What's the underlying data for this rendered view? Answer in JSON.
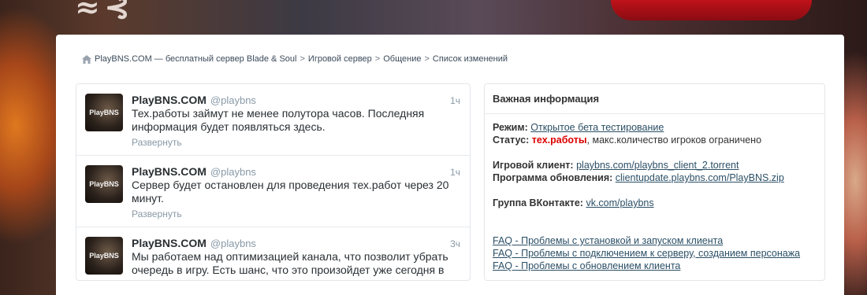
{
  "breadcrumb": {
    "home_icon": "home-icon",
    "items": [
      "PlayBNS.COM — бесплатный сервер Blade & Soul",
      "Игровой сервер",
      "Общение",
      "Список изменений"
    ],
    "separator": ">"
  },
  "tweets": [
    {
      "avatar_text": "PlayBNS",
      "name": "PlayBNS.COM",
      "handle": "@playbns",
      "time": "1ч",
      "text": "Тех.работы займут не менее полутора часов. Последняя информация будет появляться здесь.",
      "expand": "Развернуть"
    },
    {
      "avatar_text": "PlayBNS",
      "name": "PlayBNS.COM",
      "handle": "@playbns",
      "time": "1ч",
      "text": "Сервер будет остановлен для проведения тех.работ через 20 минут.",
      "expand": "Развернуть"
    },
    {
      "avatar_text": "PlayBNS",
      "name": "PlayBNS.COM",
      "handle": "@playbns",
      "time": "3ч",
      "text": "Мы работаем над оптимизацией канала, что позволит убрать очередь в игру. Есть шанс, что это произойдет уже сегодня в",
      "expand": ""
    }
  ],
  "info": {
    "title": "Важная информация",
    "mode_label": "Режим:",
    "mode_value": "Открытое бета тестирование",
    "status_label": "Статус:",
    "status_value": "тех.работы",
    "status_note": ", макс.количество игроков ограничено",
    "client_label": "Игровой клиент:",
    "client_link": "playbns.com/playbns_client_2.torrent",
    "update_label": "Программа обновления:",
    "update_link": "clientupdate.playbns.com/PlayBNS.zip",
    "vk_label": "Группа ВКонтакте:",
    "vk_link": "vk.com/playbns",
    "faq": [
      "FAQ - Проблемы с установкой и запуском клиента",
      "FAQ - Проблемы с подключением к серверу, созданием персонажа",
      "FAQ - Проблемы с обновлением клиента"
    ]
  },
  "colors": {
    "status_red": "#dd0000",
    "link": "#2b4f66",
    "muted": "#8899a6"
  }
}
